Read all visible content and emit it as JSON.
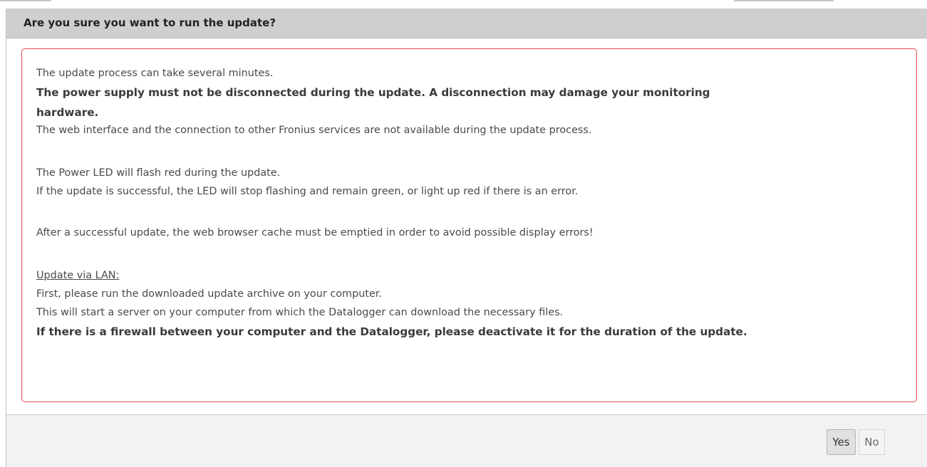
{
  "dialog": {
    "title": "Are you sure you want to run the update?",
    "lines": {
      "l1": "The update process can take several minutes.",
      "l2": "The power supply must not be disconnected during the update. A disconnection may damage your monitoring",
      "l3": "hardware.",
      "l4": "The web interface and the connection to other Fronius services are not available during the update process.",
      "l5": "The Power LED will flash red during the update.",
      "l6": "If the update is successful, the LED will stop flashing and remain green, or light up red if there is an error.",
      "l7": "After a successful update, the web browser cache must be emptied in order to avoid possible display errors!",
      "l8": "Update via LAN:",
      "l9": "First, please run the downloaded update archive on your computer.",
      "l10": "This will start a server on your computer from which the Datalogger can download the necessary files.",
      "l11": "If there is a firewall between your computer and the Datalogger, please deactivate it for the duration of the update."
    },
    "buttons": {
      "yes": "Yes",
      "no": "No"
    },
    "colors": {
      "header_bg": "#cfcfcf",
      "warning_border": "#e8474b",
      "footer_bg": "#f2f2f2"
    }
  }
}
